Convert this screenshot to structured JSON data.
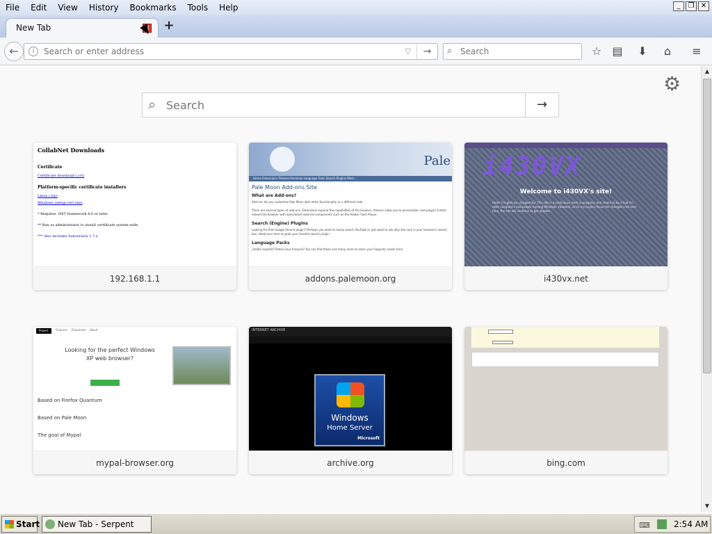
{
  "menubar": {
    "items": [
      "File",
      "Edit",
      "View",
      "History",
      "Bookmarks",
      "Tools",
      "Help"
    ]
  },
  "tab": {
    "title": "New Tab"
  },
  "navbar": {
    "url_placeholder": "Search or enter address",
    "search_placeholder": "Search"
  },
  "newtab": {
    "search_placeholder": "Search",
    "tiles": [
      {
        "label": "192.168.1.1",
        "thumb": {
          "heading": "CollabNet Downloads",
          "sub1": "Certificate",
          "link1": "Certificate download (.crt)",
          "sub2": "Platform-specific certificate installers",
          "link2": "Linux (.zip)",
          "link3": "Windows (setup-cert.exe)",
          "text1": "* Requires .NET framework 4.0 or later.",
          "text2": "** Run as administrator to install certificate system-wide",
          "text3": "*** Also includes Subversion 1.7.x"
        }
      },
      {
        "label": "addons.palemoon.org",
        "thumb": {
          "logo": "Pale",
          "nav": "Home  Extensions  Themes  Personas  Language Tools  Search Plugins  More...",
          "heading": "Pale Moon Add-ons Site",
          "s1": "What are Add-ons?",
          "t1": "Add-ons let you customize Pale Moon with extra functionality or a different look.",
          "t2": "There are several types of add-ons. Extensions expand the capabilities of the browser, themes allow you to personalize, and plugins further extend the browser with specialized external components such as the Adobe Flash Player.",
          "s2": "Search (Engine) Plugins",
          "t3": "Looking for that Google Search plugin? Perhaps you want to easily search YouTube or just want to ask why Ask.com is your browser's search box. Head over here to grab your favorite search plugin.",
          "s3": "Language Packs",
          "t4": "¿Habla español? Parlez-vous français? You can find these and many more to solve your linguistic needs here."
        }
      },
      {
        "label": "i430vx.net",
        "thumb": {
          "logo": "i430VX",
          "welcome": "Welcome to i430VX's site!",
          "text": "Hello! I'm glad you stopped by! This site is a continuous work-in-progress, and meant to be a hub for older computers and people running Windows. However, since my project focus has changed a bit over time, the site will continue to get updates."
        }
      },
      {
        "label": "mypal-browser.org",
        "thumb": {
          "nav": [
            "Project",
            "Features",
            "Download",
            "About"
          ],
          "hero": "Looking for the perfect Windows XP web browser?",
          "s1": "Based on Firefox Quantum",
          "s2": "Based on Pale Moon",
          "s3": "The goal of Mypal"
        }
      },
      {
        "label": "archive.org",
        "thumb": {
          "brand": "INTERNET ARCHIVE",
          "w1": "Windows",
          "w2": "Home Server",
          "ms": "Microsoft"
        }
      },
      {
        "label": "bing.com",
        "thumb": {}
      }
    ]
  },
  "taskbar": {
    "start": "Start",
    "task": "New Tab - Serpent",
    "clock": "2:54 AM"
  }
}
